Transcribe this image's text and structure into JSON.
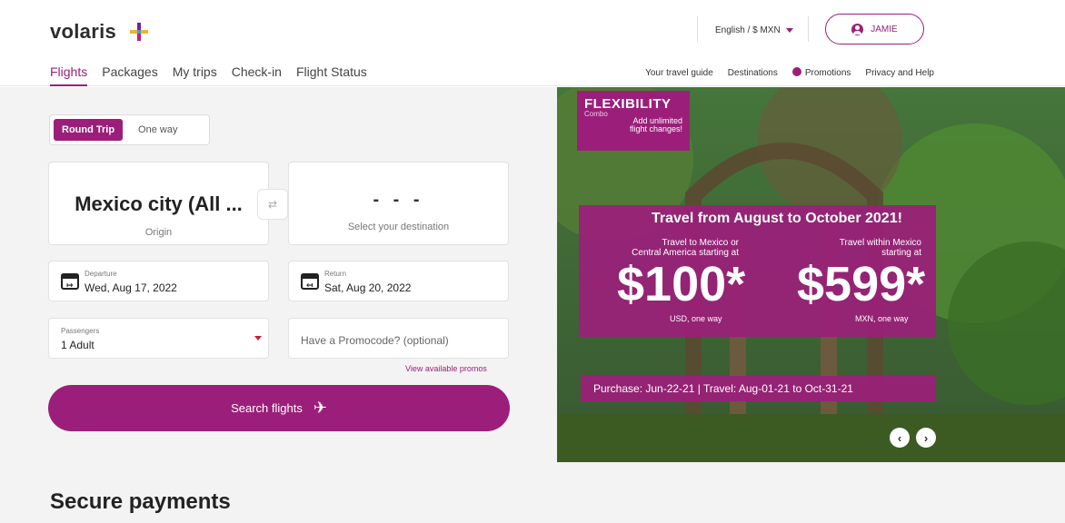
{
  "brand": {
    "name": "volaris",
    "accent": "#9b1f7a"
  },
  "header": {
    "lang_label": "English / $ MXN",
    "user_label": "JAMIE",
    "tabs": [
      {
        "label": "Flights",
        "active": true
      },
      {
        "label": "Packages"
      },
      {
        "label": "My trips"
      },
      {
        "label": "Check-in"
      },
      {
        "label": "Flight Status"
      }
    ],
    "sublinks": [
      "Your travel guide",
      "Destinations",
      "Promotions",
      "Privacy and Help"
    ]
  },
  "booking": {
    "trip_types": [
      "Round Trip",
      "One way"
    ],
    "origin_value": "Mexico city (All ...",
    "origin_label": "Origin",
    "destination_value": "- - -",
    "destination_label": "Select your destination",
    "swap_icon": "swap-arrows-icon",
    "departure_label": "Departure",
    "departure_value": "Wed, Aug 17, 2022",
    "return_label": "Return",
    "return_value": "Sat, Aug 20, 2022",
    "passengers_label": "Passengers",
    "passengers_value": "1 Adult",
    "promo_placeholder": "Have a Promocode? (optional)",
    "view_promos": "View available promos",
    "search_label": "Search flights"
  },
  "hero": {
    "badge_title": "FLEXIBILITY",
    "badge_sub": "Combo",
    "badge_text1": "Add unlimited",
    "badge_text2": "flight changes!",
    "headline": "Travel from August to October 2021!",
    "left_text1": "Travel to Mexico or",
    "left_text2": "Central America starting at",
    "left_price": "$100*",
    "left_unit": "USD, one way",
    "right_text1": "Travel within Mexico",
    "right_text2": "starting at",
    "right_price": "$599*",
    "right_unit": "MXN, one way",
    "purchase_bar": "Purchase: Jun-22-21 | Travel: Aug-01-21 to Oct-31-21"
  },
  "footer": {
    "secure_title": "Secure payments"
  }
}
